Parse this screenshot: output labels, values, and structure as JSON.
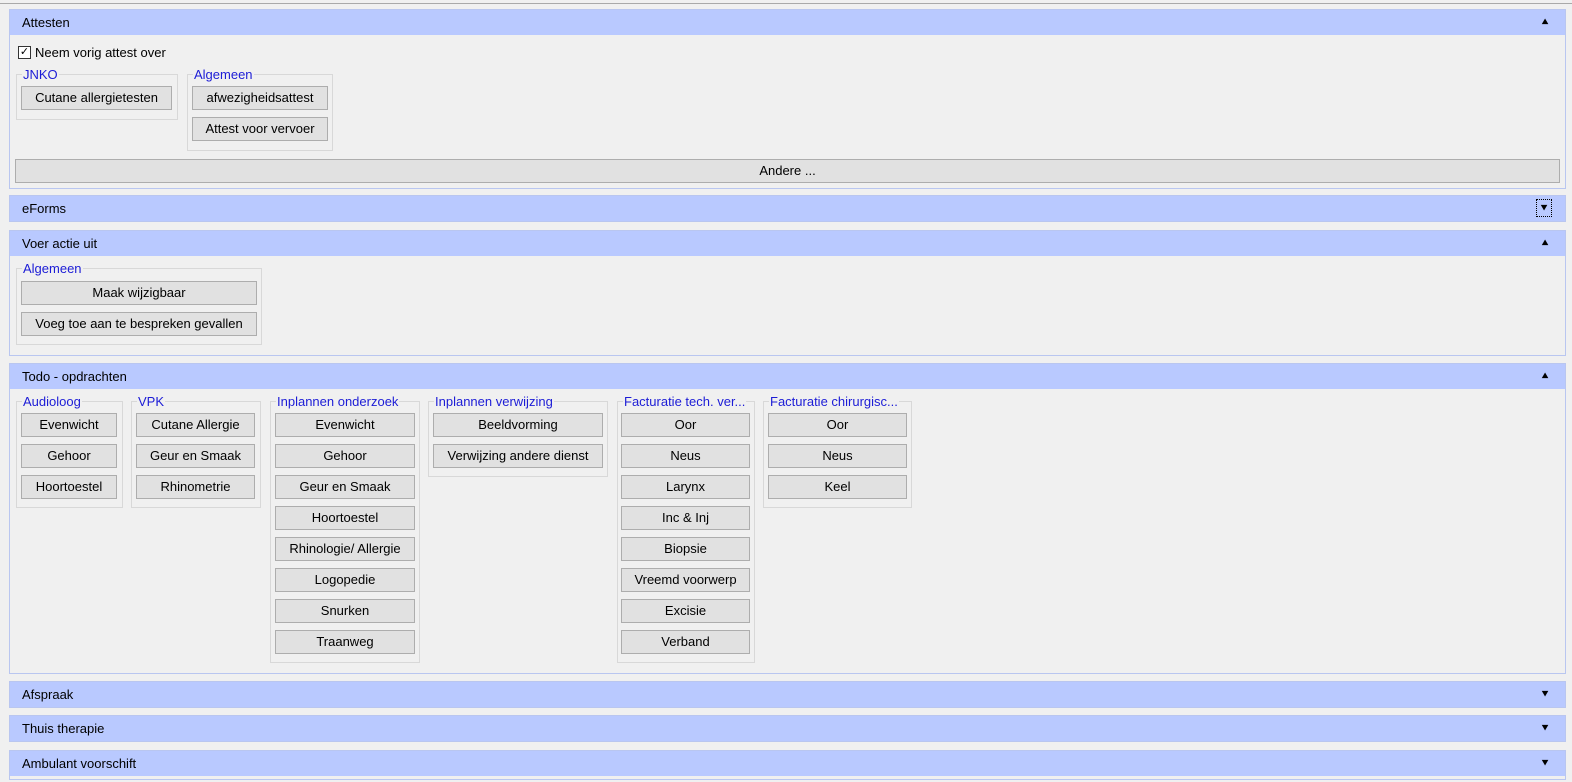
{
  "attesten": {
    "title": "Attesten",
    "collapse_icon": "chevron-double-up-icon",
    "checkbox_label": "Neem vorig attest over",
    "checkbox_checked": true,
    "groups": [
      {
        "label": "JNKO",
        "buttons": [
          "Cutane allergietesten"
        ]
      },
      {
        "label": "Algemeen",
        "buttons": [
          "afwezigheidsattest",
          "Attest voor vervoer"
        ]
      }
    ],
    "other_button": "Andere ..."
  },
  "eforms": {
    "title": "eForms",
    "expand_icon": "chevron-double-down-icon"
  },
  "voer_actie_uit": {
    "title": "Voer actie uit",
    "collapse_icon": "chevron-double-up-icon",
    "groups": [
      {
        "label": "Algemeen",
        "buttons": [
          "Maak wijzigbaar",
          "Voeg toe aan te bespreken gevallen"
        ]
      }
    ]
  },
  "todo": {
    "title": "Todo - opdrachten",
    "collapse_icon": "chevron-double-up-icon",
    "groups": [
      {
        "label": "Audioloog",
        "buttons": [
          "Evenwicht",
          "Gehoor",
          "Hoortoestel"
        ]
      },
      {
        "label": "VPK",
        "buttons": [
          "Cutane Allergie",
          "Geur en Smaak",
          "Rhinometrie"
        ]
      },
      {
        "label": "Inplannen onderzoek",
        "buttons": [
          "Evenwicht",
          "Gehoor",
          "Geur en Smaak",
          "Hoortoestel",
          "Rhinologie/ Allergie",
          "Logopedie",
          "Snurken",
          "Traanweg"
        ]
      },
      {
        "label": "Inplannen verwijzing",
        "buttons": [
          "Beeldvorming",
          "Verwijzing andere dienst"
        ]
      },
      {
        "label": "Facturatie tech. ver...",
        "buttons": [
          "Oor",
          "Neus",
          "Larynx",
          "Inc & Inj",
          "Biopsie",
          "Vreemd voorwerp",
          "Excisie",
          "Verband"
        ]
      },
      {
        "label": "Facturatie chirurgisc...",
        "buttons": [
          "Oor",
          "Neus",
          "Keel"
        ]
      }
    ]
  },
  "afspraak": {
    "title": "Afspraak",
    "expand_icon": "chevron-double-down-icon"
  },
  "thuis_therapie": {
    "title": "Thuis therapie",
    "expand_icon": "chevron-double-down-icon"
  },
  "ambulant_voorschift": {
    "title": "Ambulant voorschift",
    "expand_icon": "chevron-double-down-icon"
  },
  "colors": {
    "header_bg": "#b9c9ff",
    "group_label": "#1c1cd6",
    "button_bg": "#e1e1e1"
  }
}
